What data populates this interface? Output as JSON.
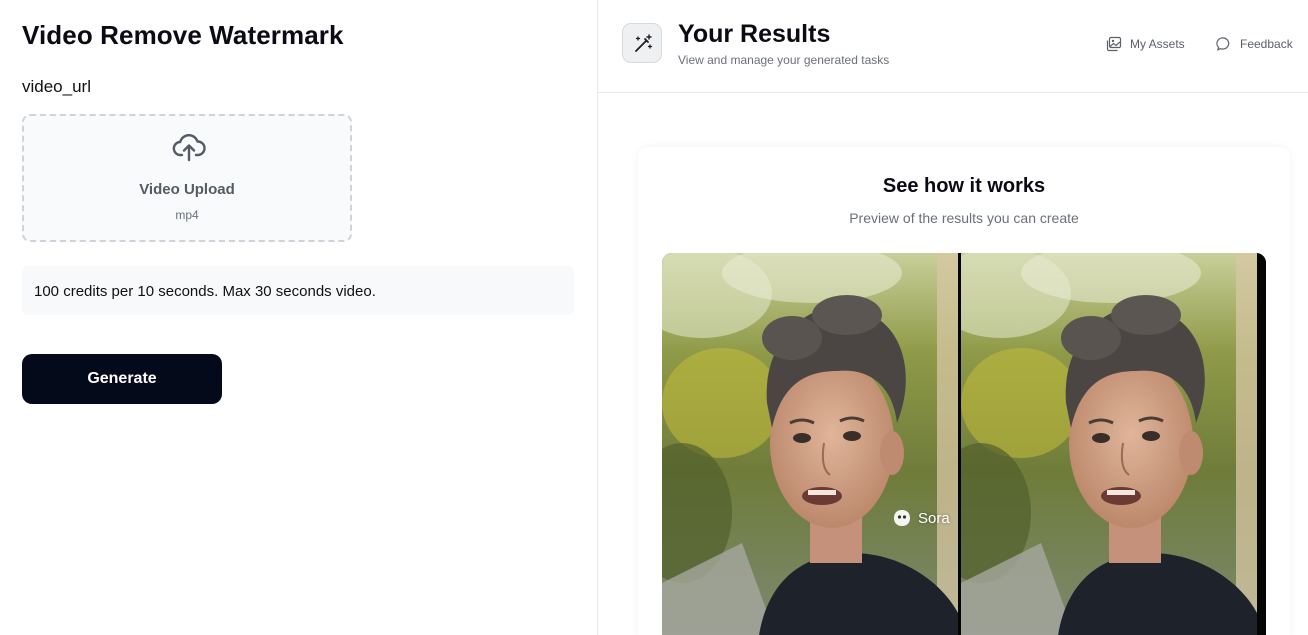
{
  "left_panel": {
    "title": "Video Remove Watermark",
    "field_label": "video_url",
    "upload": {
      "icon": "cloud-upload-icon",
      "title": "Video Upload",
      "formats": "mp4"
    },
    "info_text": "100 credits per 10 seconds. Max 30 seconds video.",
    "generate_label": "Generate"
  },
  "right_panel": {
    "header": {
      "icon": "magic-wand-icon",
      "title": "Your Results",
      "subtitle": "View and manage your generated tasks",
      "links": [
        {
          "icon": "image-gallery-icon",
          "label": "My Assets"
        },
        {
          "icon": "chat-bubble-icon",
          "label": "Feedback"
        }
      ]
    },
    "preview": {
      "title": "See how it works",
      "subtitle": "Preview of the results you can create",
      "watermark_label": "Sora"
    }
  },
  "colors": {
    "primary_button": "#050a1a",
    "upload_bg": "#f8fafc",
    "upload_border": "#cfd4da",
    "info_bg": "#f7f9fb",
    "muted_text": "#6b7078"
  }
}
